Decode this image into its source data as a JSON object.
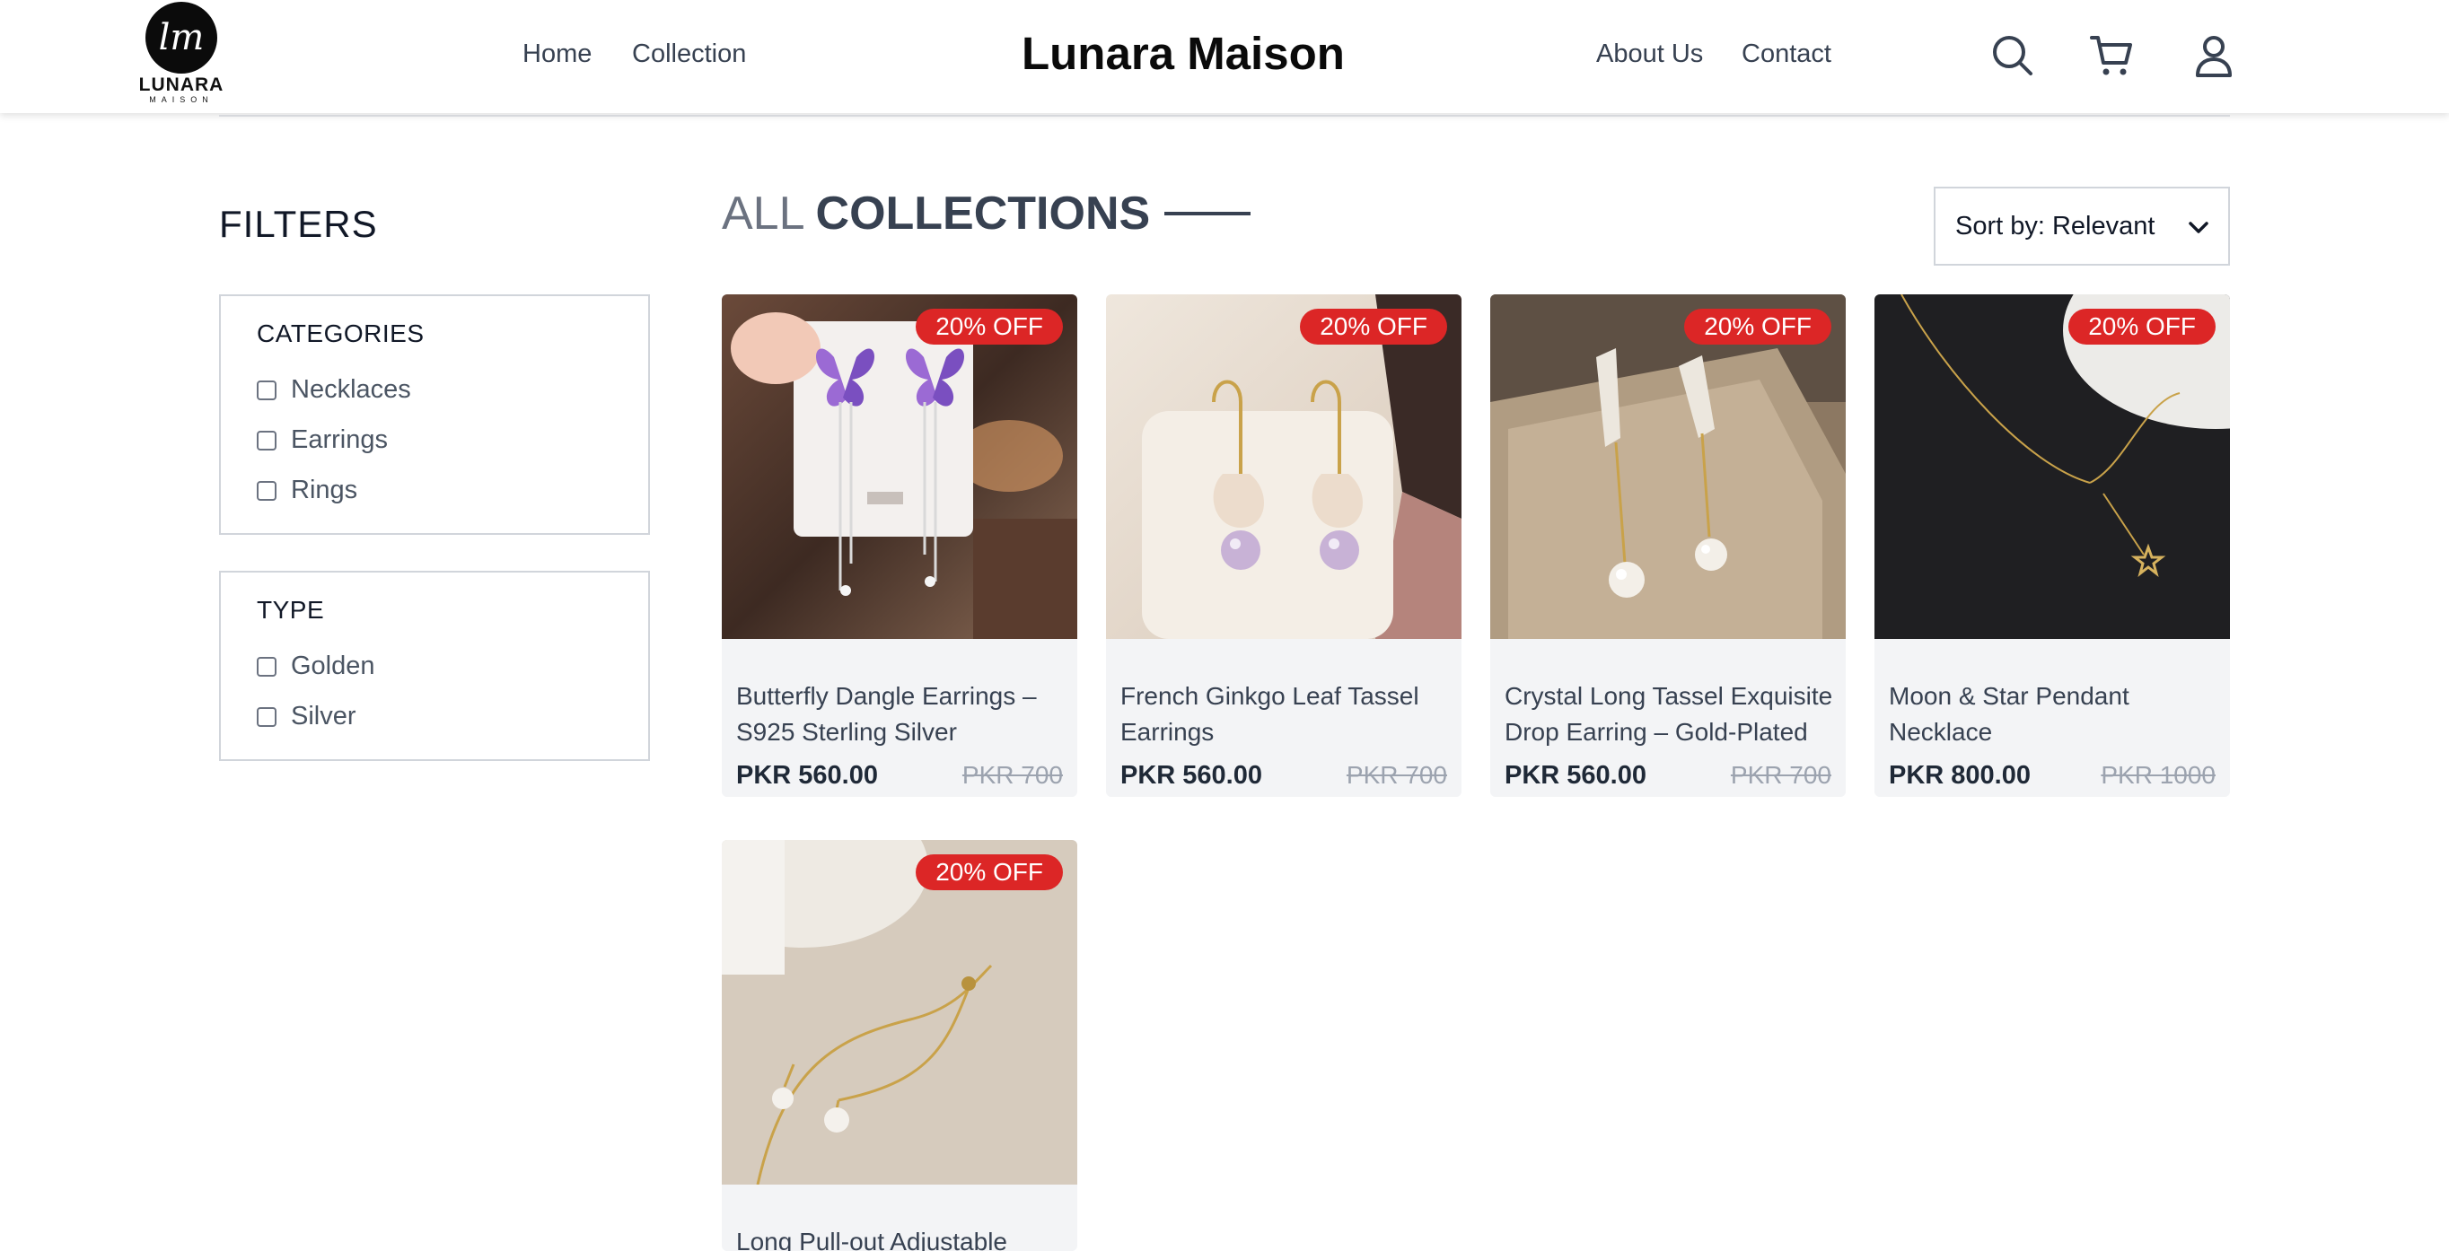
{
  "header": {
    "logo": {
      "name": "LUNARA",
      "sub": "MAISON",
      "monogram": "lm"
    },
    "nav_left": [
      "Home",
      "Collection"
    ],
    "brand": "Lunara Maison",
    "nav_right": [
      "About Us",
      "Contact"
    ],
    "icons": [
      "search-icon",
      "cart-icon",
      "user-icon"
    ]
  },
  "filters": {
    "title": "FILTERS",
    "categories": {
      "heading": "CATEGORIES",
      "options": [
        "Necklaces",
        "Earrings",
        "Rings"
      ]
    },
    "type": {
      "heading": "TYPE",
      "options": [
        "Golden",
        "Silver"
      ]
    }
  },
  "main": {
    "title_light": "ALL",
    "title_bold": "COLLECTIONS",
    "sort": {
      "selected": "Sort by: Relevant"
    }
  },
  "products": [
    {
      "name": "Butterfly Dangle Earrings – S925 Sterling Silver",
      "price": "PKR 560.00",
      "old_price": "PKR 700",
      "badge": "20% OFF"
    },
    {
      "name": "French Ginkgo Leaf Tassel Earrings",
      "price": "PKR 560.00",
      "old_price": "PKR 700",
      "badge": "20% OFF"
    },
    {
      "name": "Crystal Long Tassel Exquisite Drop Earring – Gold-Plated",
      "price": "PKR 560.00",
      "old_price": "PKR 700",
      "badge": "20% OFF"
    },
    {
      "name": "Moon & Star Pendant Necklace",
      "price": "PKR 800.00",
      "old_price": "PKR 1000",
      "badge": "20% OFF"
    },
    {
      "name": "Long Pull-out Adjustable",
      "badge": "20% OFF"
    }
  ],
  "colors": {
    "badge": "#dc2626",
    "card_bg": "#f3f4f6",
    "text_dark": "#374151"
  }
}
